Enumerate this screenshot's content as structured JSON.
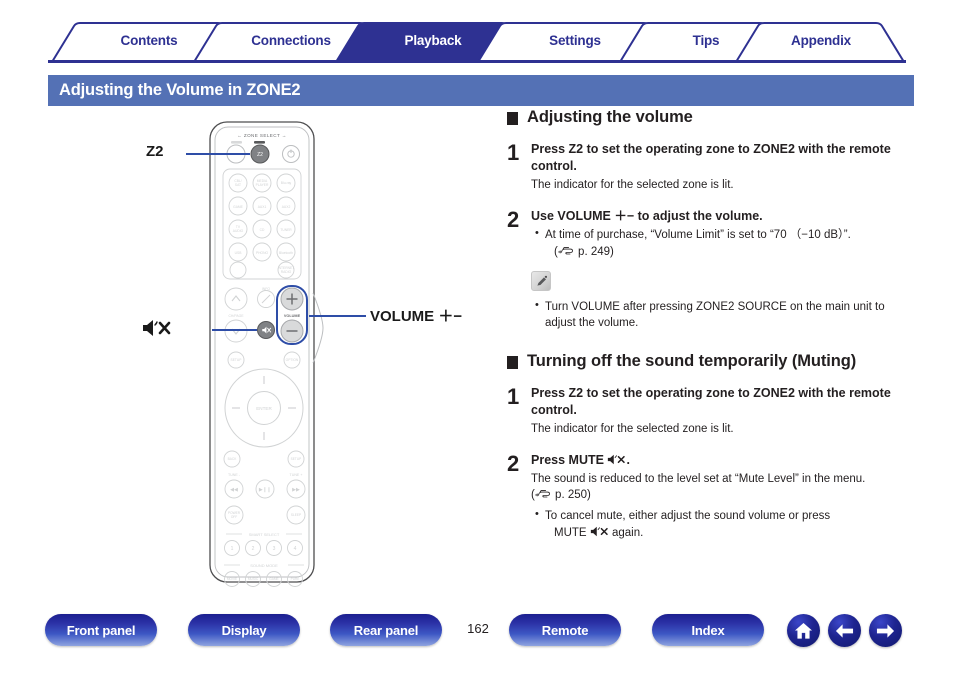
{
  "tabs": [
    {
      "label": "Contents",
      "active": false
    },
    {
      "label": "Connections",
      "active": false
    },
    {
      "label": "Playback",
      "active": true
    },
    {
      "label": "Settings",
      "active": false
    },
    {
      "label": "Tips",
      "active": false
    },
    {
      "label": "Appendix",
      "active": false
    }
  ],
  "page_title": "Adjusting the Volume in ZONE2",
  "illustration": {
    "device": "remote-control",
    "callouts": [
      {
        "id": "z2",
        "label": "Z2"
      },
      {
        "id": "volume",
        "label": "VOLUME ＋−"
      },
      {
        "id": "mute",
        "label": "mute-icon"
      }
    ],
    "remote_labels": {
      "zone_select": "ZONE SELECT",
      "volume": "VOLUME",
      "enter": "ENTER",
      "tune_minus": "TUNE -",
      "tune_plus": "TUNE +",
      "smart_select": "SMART SELECT",
      "sound_mode": "SOUND MODE",
      "smart_numbers": [
        "1",
        "2",
        "3",
        "4"
      ],
      "sound_modes": [
        "MOVIE",
        "MUSIC",
        "GAME",
        "PURE"
      ]
    }
  },
  "sections": [
    {
      "heading": "Adjusting the volume",
      "steps": [
        {
          "num": "1",
          "title": "Press Z2 to set the operating zone to ZONE2 with the remote control.",
          "sub": "The indicator for the selected zone is lit.",
          "bullets": [],
          "note": null
        },
        {
          "num": "2",
          "title": "Use VOLUME ＋− to adjust the volume.",
          "sub": null,
          "bullets": [
            {
              "text": "At time of purchase, “Volume Limit” is set to “70 （−10 dB）”.",
              "ref": "p. 249"
            }
          ],
          "note": {
            "icon": "pencil-icon",
            "bullets": [
              {
                "text": "Turn VOLUME after pressing ZONE2 SOURCE on the main unit to adjust the volume.",
                "ref": null
              }
            ]
          }
        }
      ]
    },
    {
      "heading": "Turning off the sound temporarily (Muting)",
      "steps": [
        {
          "num": "1",
          "title": "Press Z2 to set the operating zone to ZONE2 with the remote control.",
          "sub": "The indicator for the selected zone is lit.",
          "bullets": [],
          "note": null
        },
        {
          "num": "2",
          "title": "Press MUTE ⧸.",
          "sub": "The sound is reduced to the level set at “Mute Level” in the menu.",
          "sub_ref": "p. 250",
          "bullets": [
            {
              "text": "To cancel mute, either adjust the sound volume or press MUTE again.",
              "ref": null
            }
          ],
          "note": null
        }
      ]
    }
  ],
  "footer": {
    "buttons": [
      {
        "id": "front-panel",
        "label": "Front panel"
      },
      {
        "id": "display",
        "label": "Display"
      },
      {
        "id": "rear-panel",
        "label": "Rear panel"
      },
      {
        "id": "remote",
        "label": "Remote"
      },
      {
        "id": "index",
        "label": "Index"
      }
    ],
    "page_number": "162",
    "nav_icons": [
      "home-icon",
      "arrow-left-icon",
      "arrow-right-icon"
    ]
  },
  "colors": {
    "tab_active_bg": "#2e3192",
    "tab_text": "#2e3192",
    "title_bar_bg": "#5471b5",
    "callout_line": "#2e4da7",
    "text": "#231f20"
  }
}
